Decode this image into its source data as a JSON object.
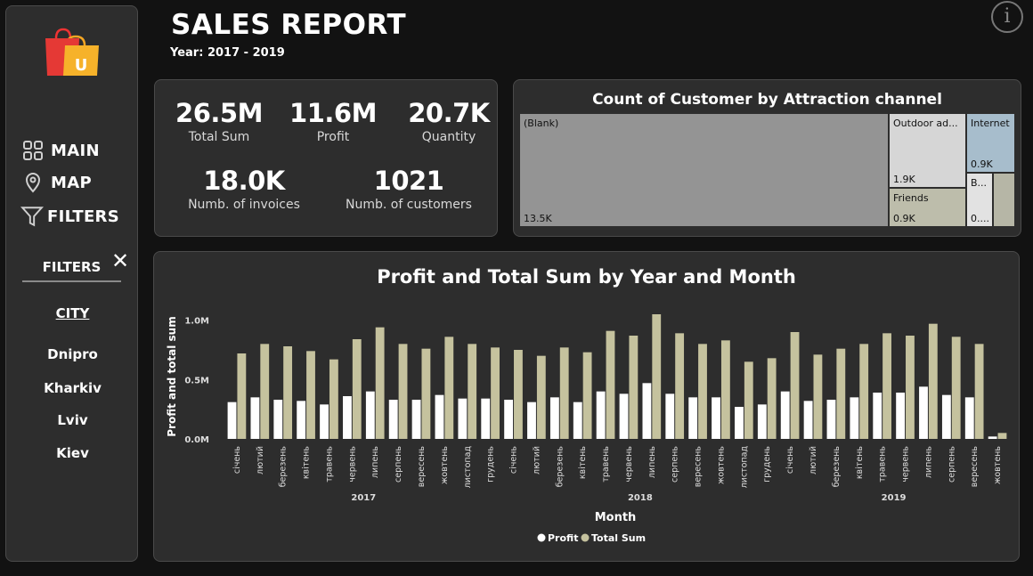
{
  "header": {
    "title": "SALES REPORT",
    "subtitle": "Year: 2017 - 2019",
    "info_icon_glyph": "i"
  },
  "nav": {
    "main": "MAIN",
    "map": "MAP",
    "filters": "FILTERS"
  },
  "filters_panel": {
    "title": "FILTERS",
    "close_glyph": "✕",
    "city_label": "CITY",
    "cities": [
      "Dnipro",
      "Kharkiv",
      "Lviv",
      "Kiev"
    ]
  },
  "kpis": {
    "total_sum": {
      "value": "26.5M",
      "label": "Total Sum"
    },
    "profit": {
      "value": "11.6M",
      "label": "Profit"
    },
    "quantity": {
      "value": "20.7K",
      "label": "Quantity"
    },
    "invoices": {
      "value": "18.0K",
      "label": "Numb. of invoices"
    },
    "customers": {
      "value": "1021",
      "label": "Numb. of customers"
    }
  },
  "treemap": {
    "title": "Count of Customer by Attraction channel",
    "tiles": {
      "blank": {
        "name": "(Blank)",
        "value": "13.5K",
        "color": "#949494"
      },
      "outdoor": {
        "name": "Outdoor ad...",
        "value": "1.9K",
        "color": "#d6d6d6"
      },
      "internet": {
        "name": "Internet",
        "value": "0.9K",
        "color": "#a7bdcc"
      },
      "friends": {
        "name": "Friends",
        "value": "0.9K",
        "color": "#bdbdab"
      },
      "b": {
        "name": "B...",
        "value": "0....",
        "color": "#e2e2e2"
      },
      "other": {
        "color": "#b6b6a6"
      }
    }
  },
  "chart_data": {
    "type": "bar",
    "title": "Profit and Total Sum by Year and Month",
    "xlabel": "Month",
    "ylabel": "Profit and total sum",
    "ylim": [
      0,
      1050000
    ],
    "yticks": [
      "0.0M",
      "0.5M",
      "1.0M"
    ],
    "years": [
      "2017",
      "2018",
      "2019"
    ],
    "categories": [
      "січень",
      "лютий",
      "березень",
      "квітень",
      "травень",
      "червень",
      "липень",
      "серпень",
      "вересень",
      "жовтень",
      "листопад",
      "грудень",
      "січень",
      "лютий",
      "березень",
      "квітень",
      "травень",
      "червень",
      "липень",
      "серпень",
      "вересень",
      "жовтень",
      "листопад",
      "грудень",
      "січень",
      "лютий",
      "березень",
      "квітень",
      "травень",
      "червень",
      "липень",
      "серпень",
      "вересень",
      "жовтень"
    ],
    "series": [
      {
        "name": "Profit",
        "color": "#ffffff",
        "values": [
          310000,
          350000,
          330000,
          320000,
          290000,
          360000,
          400000,
          330000,
          330000,
          370000,
          340000,
          340000,
          330000,
          310000,
          350000,
          310000,
          400000,
          380000,
          470000,
          380000,
          350000,
          350000,
          270000,
          290000,
          400000,
          320000,
          330000,
          350000,
          390000,
          390000,
          440000,
          370000,
          350000,
          20000
        ]
      },
      {
        "name": "Total Sum",
        "color": "#c5c29e",
        "values": [
          720000,
          800000,
          780000,
          740000,
          670000,
          840000,
          940000,
          800000,
          760000,
          860000,
          800000,
          770000,
          750000,
          700000,
          770000,
          730000,
          910000,
          870000,
          1050000,
          890000,
          800000,
          830000,
          650000,
          680000,
          900000,
          710000,
          760000,
          800000,
          890000,
          870000,
          970000,
          860000,
          800000,
          50000
        ]
      }
    ],
    "legend": "bottom-center"
  }
}
